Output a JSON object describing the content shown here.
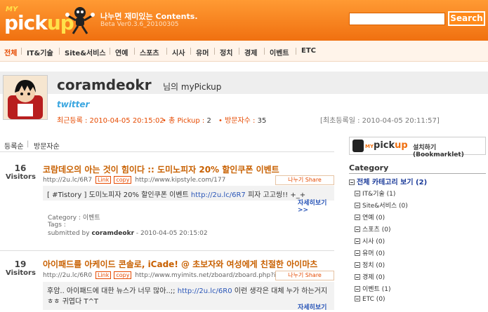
{
  "header": {
    "logo_my": "MY",
    "logo_pick": "pick",
    "logo_up": "up",
    "tagline": "나누면 재미있는 Contents.",
    "version": "Beta Ver0.3.6_20100305",
    "search_button": "Search"
  },
  "nav": [
    "전체",
    "IT&기술",
    "Site&서비스",
    "연예",
    "스포츠",
    "시사",
    "유머",
    "정치",
    "경제",
    "이벤트",
    "ETC"
  ],
  "profile": {
    "username": "coramdeokr",
    "suffix": "님의 myPickup",
    "twitter": "twitter",
    "recent": "최근등록 : 2010-04-05 20:15:02",
    "pickup": "총 Pickup : ",
    "pickup_val": "2",
    "visits": "방문자수 : ",
    "visits_val": "35",
    "first": "[최초등록일 : 2010-04-05 20:11:57]"
  },
  "sort": [
    "등록순",
    "방문자순"
  ],
  "posts": [
    {
      "count": "16",
      "count_label": "Visitors",
      "title": "코람데오의 아는 것이 힘이다 :: 도미노피자 20% 할인쿠폰 이벤트",
      "short_url": "http://2u.lc/6R7",
      "link_tag": "Link",
      "copy_tag": "copy",
      "source_url": "http://www.kipstyle.com/177",
      "share": "나누기 Share",
      "desc_a": "[ #Tistory ] 도미노피자 20% 할인쿠폰 이벤트 ",
      "desc_link": "http://2u.lc/6R7",
      "desc_b": " 피자 고고씽!! +_+",
      "more": "자세히보기 >>",
      "category": "Category : 이벤트",
      "tags": "Tags :",
      "submitted_prefix": "submitted by ",
      "submitted_user": "coramdeokr",
      "submitted_date": " - 2010-04-05 20:15:02"
    },
    {
      "count": "19",
      "count_label": "Visitors",
      "title": "아이패드를 아케이드 콘솔로, iCade! @ 초보자와 여성에게 친절한 아이마츠",
      "short_url": "http://2u.lc/6R0",
      "link_tag": "Link",
      "copy_tag": "copy",
      "source_url": "http://www.myimits.net/zboard/zboard.php?id=",
      "share": "나누기 Share",
      "desc_a": "후암.. 아이패드에 대한 뉴스가 너무 많아..;; ",
      "desc_link": "http://2u.lc/6R0",
      "desc_b": " 이런 생각은 대체 누가 하는거지",
      "desc_c": "ㅎㅎ 귀엽다 T^T",
      "more": "자세히보기 >>"
    }
  ],
  "sidebar": {
    "bookmarklet_my": "MY",
    "bookmarklet_pick": "pick",
    "bookmarklet_up": "up",
    "bookmarklet_text": "설치하기 (Bookmarklet)",
    "category_title": "Category",
    "all_categories": "전체 카테고리 보기 (2)",
    "categories": [
      "IT&기술 (1)",
      "Site&서비스 (0)",
      "연예 (0)",
      "스포츠 (0)",
      "시사 (0)",
      "유머 (0)",
      "정치 (0)",
      "경제 (0)",
      "이벤트 (1)",
      "ETC (0)"
    ]
  },
  "colors": {
    "header_orange": "#f07010",
    "accent": "#e64a00",
    "link": "#2a56b8"
  }
}
